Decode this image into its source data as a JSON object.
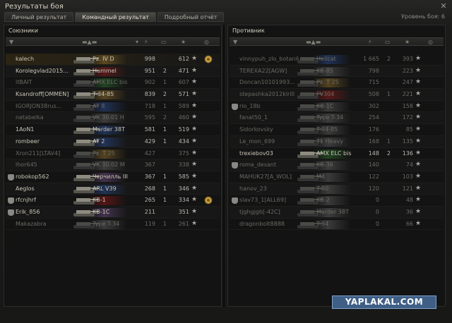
{
  "window": {
    "title": "Результаты боя",
    "close_icon": "close-icon"
  },
  "tabs": [
    {
      "label": "Личный результат",
      "active": false
    },
    {
      "label": "Командный результат",
      "active": true
    },
    {
      "label": "Подробный отчёт",
      "active": false
    }
  ],
  "battle_level": "Уровень боя: 6",
  "allies": {
    "title": "Союзники",
    "players": [
      {
        "name": "kalech",
        "tank": "Pz. IV D",
        "dmg": "998",
        "frags": "",
        "xp": "612",
        "cls": "#8a6a2a",
        "platoon": false,
        "dead": false,
        "medal": true,
        "self": true
      },
      {
        "name": "Korolegvlad2015...",
        "tank": "Hummel",
        "dmg": "951",
        "frags": "2",
        "xp": "471",
        "cls": "#8c1a1a",
        "platoon": false,
        "dead": false,
        "medal": false,
        "self": false
      },
      {
        "name": "itBAIT",
        "tank": "AMX ELC bis",
        "dmg": "902",
        "frags": "1",
        "xp": "607",
        "cls": "#2f6b2f",
        "platoon": false,
        "dead": true,
        "medal": false,
        "self": false
      },
      {
        "name": "Ksandroff[OMMEN]",
        "tank": "T-34-85",
        "dmg": "839",
        "frags": "2",
        "xp": "571",
        "cls": "#8a6a2a",
        "platoon": false,
        "dead": false,
        "medal": false,
        "self": false
      },
      {
        "name": "IGORJON38rus...",
        "tank": "AT 8",
        "dmg": "718",
        "frags": "1",
        "xp": "589",
        "cls": "#2a4a8a",
        "platoon": false,
        "dead": true,
        "medal": false,
        "self": false
      },
      {
        "name": "netabelka",
        "tank": "VK 30.01 H",
        "dmg": "595",
        "frags": "2",
        "xp": "460",
        "cls": "#5a5a5a",
        "platoon": false,
        "dead": true,
        "medal": false,
        "self": false
      },
      {
        "name": "1AoN1",
        "tank": "Marder 38T",
        "dmg": "581",
        "frags": "1",
        "xp": "519",
        "cls": "#2a4a8a",
        "platoon": false,
        "dead": false,
        "medal": false,
        "self": false
      },
      {
        "name": "rombeer",
        "tank": "AT 2",
        "dmg": "429",
        "frags": "1",
        "xp": "434",
        "cls": "#2a4a8a",
        "platoon": false,
        "dead": false,
        "medal": false,
        "self": false
      },
      {
        "name": "Xron211[LTAV4]",
        "tank": "Pz. T 25",
        "dmg": "427",
        "frags": "",
        "xp": "375",
        "cls": "#8a6a2a",
        "platoon": false,
        "dead": true,
        "medal": false,
        "self": false
      },
      {
        "name": "lhor645",
        "tank": "VK 30.02 M",
        "dmg": "367",
        "frags": "",
        "xp": "338",
        "cls": "#5a5a5a",
        "platoon": false,
        "dead": true,
        "medal": false,
        "self": false
      },
      {
        "name": "robokop562",
        "tank": "Черчилль III",
        "dmg": "367",
        "frags": "1",
        "xp": "585",
        "cls": "#6a4a7a",
        "platoon": true,
        "dead": false,
        "medal": false,
        "self": false
      },
      {
        "name": "Aeglos",
        "tank": "ARL V39",
        "dmg": "268",
        "frags": "1",
        "xp": "346",
        "cls": "#2a4a8a",
        "platoon": false,
        "dead": false,
        "medal": false,
        "self": false
      },
      {
        "name": "rfcnjhrf",
        "tank": "KB-1",
        "dmg": "265",
        "frags": "1",
        "xp": "334",
        "cls": "#8c1a1a",
        "platoon": true,
        "dead": false,
        "medal": true,
        "self": false
      },
      {
        "name": "Erik_856",
        "tank": "KB-1C",
        "dmg": "211",
        "frags": "",
        "xp": "351",
        "cls": "#6a4a7a",
        "platoon": true,
        "dead": false,
        "medal": false,
        "self": false
      },
      {
        "name": "Makazabra",
        "tank": "Type T-34",
        "dmg": "119",
        "frags": "1",
        "xp": "261",
        "cls": "#5a5a5a",
        "platoon": false,
        "dead": true,
        "medal": false,
        "self": false
      }
    ]
  },
  "enemies": {
    "title": "Противник",
    "players": [
      {
        "name": "vinnypuh_zlo_botanik",
        "tank": "Hellcat",
        "dmg": "1 665",
        "frags": "2",
        "xp": "393",
        "cls": "#2a4a8a",
        "platoon": false,
        "dead": true,
        "medal": false,
        "self": false
      },
      {
        "name": "TEREXA22[AGW]",
        "tank": "KB-85",
        "dmg": "798",
        "frags": "",
        "xp": "223",
        "cls": "#5a5a5a",
        "platoon": false,
        "dead": true,
        "medal": false,
        "self": false
      },
      {
        "name": "Doncan10101993...",
        "tank": "Pz. T 25",
        "dmg": "715",
        "frags": "",
        "xp": "247",
        "cls": "#8a6a2a",
        "platoon": false,
        "dead": true,
        "medal": false,
        "self": false
      },
      {
        "name": "stepashka2012kirill",
        "tank": "FV304",
        "dmg": "508",
        "frags": "1",
        "xp": "221",
        "cls": "#8c1a1a",
        "platoon": false,
        "dead": true,
        "medal": false,
        "self": false
      },
      {
        "name": "rio_18b",
        "tank": "KB-1C",
        "dmg": "302",
        "frags": "",
        "xp": "158",
        "cls": "#5a5a5a",
        "platoon": true,
        "dead": true,
        "medal": false,
        "self": false
      },
      {
        "name": "fanat50_1",
        "tank": "Type T-34",
        "dmg": "254",
        "frags": "",
        "xp": "172",
        "cls": "#5a5a5a",
        "platoon": false,
        "dead": true,
        "medal": false,
        "self": false
      },
      {
        "name": "Sidorkovsky",
        "tank": "T-34-85",
        "dmg": "176",
        "frags": "",
        "xp": "85",
        "cls": "#5a5a5a",
        "platoon": false,
        "dead": true,
        "medal": false,
        "self": false
      },
      {
        "name": "Le_mon_699",
        "tank": "T1 Heavy",
        "dmg": "168",
        "frags": "1",
        "xp": "135",
        "cls": "#5a5a5a",
        "platoon": false,
        "dead": true,
        "medal": false,
        "self": false
      },
      {
        "name": "trexiebov03",
        "tank": "AMX ELC bis",
        "dmg": "148",
        "frags": "2",
        "xp": "136",
        "cls": "#2f6b2f",
        "platoon": false,
        "dead": false,
        "medal": false,
        "self": false
      },
      {
        "name": "roma_desant",
        "tank": "KB-36",
        "dmg": "140",
        "frags": "",
        "xp": "74",
        "cls": "#5a5a5a",
        "platoon": true,
        "dead": true,
        "medal": false,
        "self": false
      },
      {
        "name": "MAHUK27[A_WOL]",
        "tank": "M4",
        "dmg": "122",
        "frags": "",
        "xp": "103",
        "cls": "#5a5a5a",
        "platoon": false,
        "dead": true,
        "medal": false,
        "self": false
      },
      {
        "name": "hanov_23",
        "tank": "T-80",
        "dmg": "120",
        "frags": "",
        "xp": "121",
        "cls": "#5a5a5a",
        "platoon": false,
        "dead": true,
        "medal": false,
        "self": false
      },
      {
        "name": "slav73_1[ALL69]",
        "tank": "KB-2",
        "dmg": "0",
        "frags": "",
        "xp": "48",
        "cls": "#5a5a5a",
        "platoon": true,
        "dead": true,
        "medal": false,
        "self": false
      },
      {
        "name": "tjghgjgb[-42C]",
        "tank": "Marder 38T",
        "dmg": "0",
        "frags": "",
        "xp": "36",
        "cls": "#5a5a5a",
        "platoon": false,
        "dead": true,
        "medal": false,
        "self": false
      },
      {
        "name": "dragonbolt8888",
        "tank": "T-34",
        "dmg": "0",
        "frags": "",
        "xp": "66",
        "cls": "#5a5a5a",
        "platoon": false,
        "dead": true,
        "medal": false,
        "self": false
      }
    ]
  },
  "watermark": "YAPLAKAL.COM"
}
